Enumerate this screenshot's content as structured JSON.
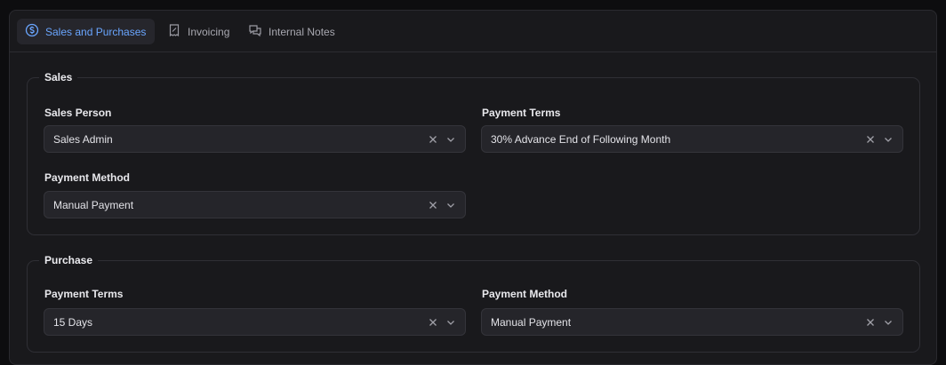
{
  "tabs": [
    {
      "label": "Sales and Purchases",
      "icon": "dollar-circle-icon",
      "active": true
    },
    {
      "label": "Invoicing",
      "icon": "receipt-icon",
      "active": false
    },
    {
      "label": "Internal Notes",
      "icon": "chat-bubbles-icon",
      "active": false
    }
  ],
  "sales": {
    "legend": "Sales",
    "sales_person": {
      "label": "Sales Person",
      "value": "Sales Admin"
    },
    "payment_terms": {
      "label": "Payment Terms",
      "value": "30% Advance End of Following Month"
    },
    "payment_method": {
      "label": "Payment Method",
      "value": "Manual Payment"
    }
  },
  "purchase": {
    "legend": "Purchase",
    "payment_terms": {
      "label": "Payment Terms",
      "value": "15 Days"
    },
    "payment_method": {
      "label": "Payment Method",
      "value": "Manual Payment"
    }
  },
  "colors": {
    "accent": "#6aa6ff",
    "panel_bg": "#19191c",
    "field_bg": "#25252a"
  }
}
